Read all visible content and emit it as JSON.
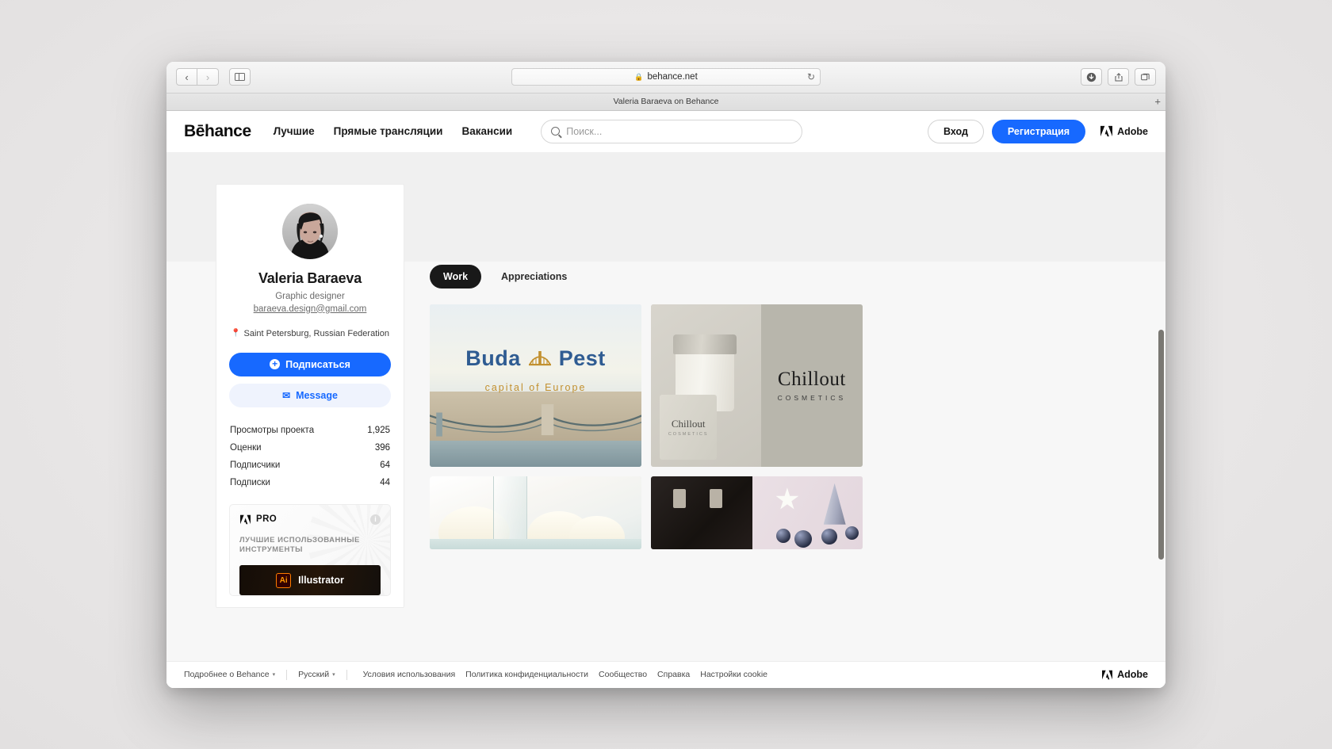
{
  "browser": {
    "url": "behance.net",
    "lock_icon": "lock-icon",
    "tab_title": "Valeria Baraeva on Behance",
    "back_icon": "chevron-left-icon",
    "forward_icon": "chevron-right-icon",
    "sidebar_icon": "sidebar-toggle-icon",
    "reload_icon": "reload-icon",
    "downloads_icon": "downloads-icon",
    "share_icon": "share-icon",
    "tabs_overview_icon": "tabs-overview-icon",
    "new_tab_icon": "plus-icon"
  },
  "nav": {
    "logo": "Bēhance",
    "links": [
      "Лучшие",
      "Прямые трансляции",
      "Вакансии"
    ],
    "search_placeholder": "Поиск...",
    "search_value": "",
    "search_icon": "search-icon",
    "login_label": "Вход",
    "signup_label": "Регистрация",
    "adobe_label": "Adobe",
    "accent_color": "#1769ff"
  },
  "profile": {
    "avatar_name": "profile-avatar",
    "name": "Valeria Baraeva",
    "role": "Graphic designer",
    "email": "baraeva.design@gmail.com",
    "location": "Saint Petersburg, Russian Federation",
    "location_icon": "map-pin-icon",
    "follow_label": "Подписаться",
    "follow_icon": "plus-circle-icon",
    "message_label": "Message",
    "message_icon": "envelope-icon",
    "stats": [
      {
        "label": "Просмотры проекта",
        "value": "1,925"
      },
      {
        "label": "Оценки",
        "value": "396"
      },
      {
        "label": "Подписчики",
        "value": "64"
      },
      {
        "label": "Подписки",
        "value": "44"
      }
    ]
  },
  "pro_card": {
    "badge": "PRO",
    "badge_icon": "adobe-logo-icon",
    "info_icon": "info-icon",
    "info_glyph": "i",
    "heading": "ЛУЧШИЕ ИСПОЛЬЗОВАННЫЕ ИНСТРУМЕНТЫ",
    "tool_abbr": "Ai",
    "tool_name": "Illustrator"
  },
  "works": {
    "tabs": [
      {
        "label": "Work",
        "active": true
      },
      {
        "label": "Appreciations",
        "active": false
      }
    ],
    "projects": [
      {
        "name": "budapest-project",
        "title_part1": "Buda",
        "title_part2": "Pest",
        "subtitle": "capital of Europe",
        "bridge_icon": "bridge-icon"
      },
      {
        "name": "chillout-cosmetics-project",
        "brand": "Chillout",
        "brand_sub": "COSMETICS",
        "box_brand": "Chillout",
        "box_sub": "COSMETICS"
      },
      {
        "name": "dessert-project"
      },
      {
        "name": "christmas-project"
      }
    ]
  },
  "footer": {
    "about": "Подробнее о Behance",
    "language": "Русский",
    "caret": "▾",
    "links": [
      "Условия использования",
      "Политика конфиденциальности",
      "Сообщество",
      "Справка",
      "Настройки cookie"
    ],
    "adobe_label": "Adobe"
  }
}
